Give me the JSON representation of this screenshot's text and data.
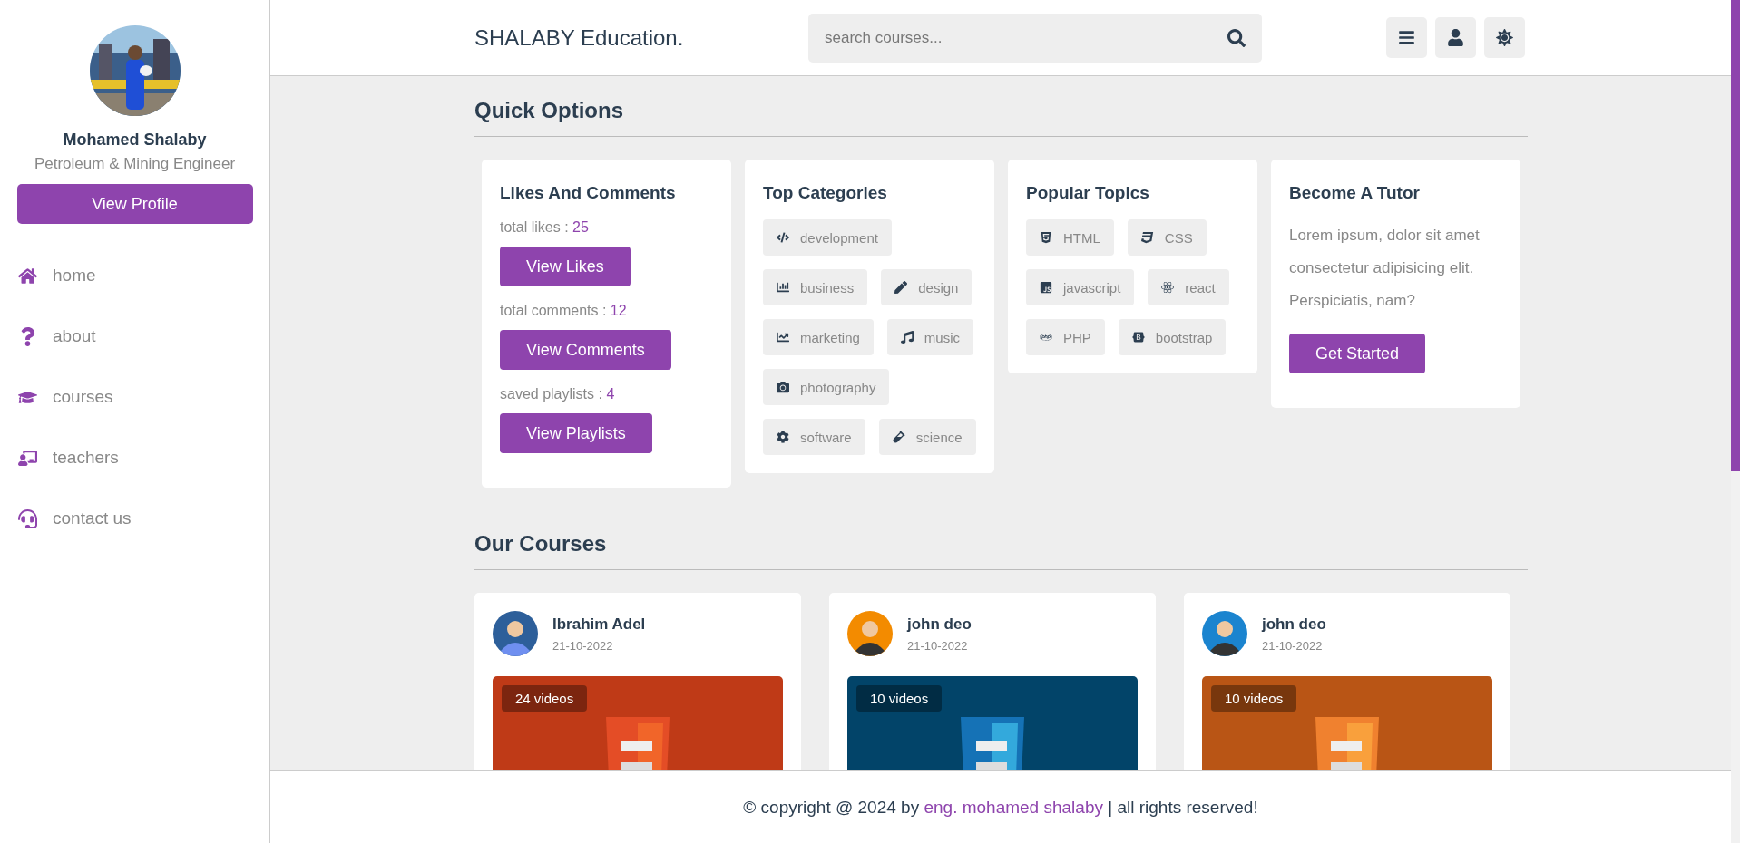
{
  "sidebar": {
    "name": "Mohamed Shalaby",
    "role": "Petroleum & Mining Engineer",
    "profile_button": "View Profile",
    "nav": [
      {
        "label": "home"
      },
      {
        "label": "about"
      },
      {
        "label": "courses"
      },
      {
        "label": "teachers"
      },
      {
        "label": "contact us"
      }
    ]
  },
  "header": {
    "logo": "SHALABY Education.",
    "search": {
      "placeholder": "search courses..."
    }
  },
  "quick_options": {
    "title": "Quick Options",
    "likes_card": {
      "title": "Likes And Comments",
      "stats": [
        {
          "label": "total likes :",
          "value": "25",
          "button": "View Likes"
        },
        {
          "label": "total comments :",
          "value": "12",
          "button": "View Comments"
        },
        {
          "label": "saved playlists :",
          "value": "4",
          "button": "View Playlists"
        }
      ]
    },
    "categories_card": {
      "title": "Top Categories",
      "tags": [
        {
          "label": "development"
        },
        {
          "label": "business"
        },
        {
          "label": "design"
        },
        {
          "label": "marketing"
        },
        {
          "label": "music"
        },
        {
          "label": "photography"
        },
        {
          "label": "software"
        },
        {
          "label": "science"
        }
      ]
    },
    "topics_card": {
      "title": "Popular Topics",
      "tags": [
        {
          "label": "HTML"
        },
        {
          "label": "CSS"
        },
        {
          "label": "javascript"
        },
        {
          "label": "react"
        },
        {
          "label": "PHP"
        },
        {
          "label": "bootstrap"
        }
      ]
    },
    "tutor_card": {
      "title": "Become A Tutor",
      "text": "Lorem ipsum, dolor sit amet consectetur adipisicing elit. Perspiciatis, nam?",
      "button": "Get Started"
    }
  },
  "courses": {
    "title": "Our Courses",
    "items": [
      {
        "author": "Ibrahim Adel",
        "date": "21-10-2022",
        "videos": "24 videos"
      },
      {
        "author": "john deo",
        "date": "21-10-2022",
        "videos": "10 videos"
      },
      {
        "author": "john deo",
        "date": "21-10-2022",
        "videos": "10 videos"
      }
    ]
  },
  "footer": {
    "before": "© copyright @ 2024 by",
    "link": "eng. mohamed shalaby",
    "after": "| all rights reserved!"
  }
}
